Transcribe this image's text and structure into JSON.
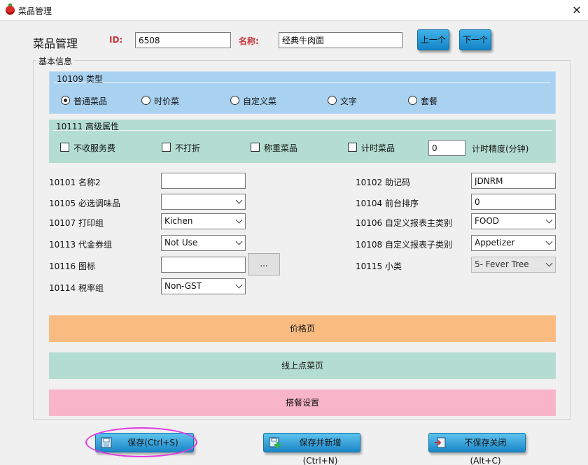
{
  "window": {
    "title": "菜品管理",
    "close_glyph": "✕"
  },
  "header": {
    "heading": "菜品管理",
    "id_label": "ID:",
    "id_value": "6508",
    "name_label": "名称:",
    "name_value": "经典牛肉面",
    "prev_label": "上一个",
    "next_label": "下一个"
  },
  "basic_group": {
    "title": "基本信息"
  },
  "type_section": {
    "title": "10109 类型",
    "options": [
      "普通菜品",
      "时价菜",
      "自定义菜",
      "文字",
      "套餐"
    ],
    "selected_index": 0
  },
  "advanced_section": {
    "title": "10111 高级属性",
    "checkboxes": [
      "不收服务费",
      "不打折",
      "称重菜品",
      "计时菜品"
    ],
    "checked": [
      false,
      false,
      false,
      false
    ],
    "precision_value": "0",
    "precision_label": "计时精度(分钟)"
  },
  "fields": {
    "name2": {
      "label": "10101 名称2",
      "value": ""
    },
    "mnemonic": {
      "label": "10102 助记码",
      "value": "JDNRM"
    },
    "seasoning": {
      "label": "10105 必选调味品",
      "value": ""
    },
    "sort": {
      "label": "10104 前台排序",
      "value": "0"
    },
    "print_group": {
      "label": "10107 打印组",
      "value": "Kichen"
    },
    "report_main": {
      "label": "10106 自定义报表主类别",
      "value": "FOOD"
    },
    "voucher_group": {
      "label": "10113 代金券组",
      "value": "Not Use"
    },
    "report_sub": {
      "label": "10108 自定义报表子类别",
      "value": "Appetizer"
    },
    "icon": {
      "label": "10116 图标",
      "value": "",
      "browse_label": "..."
    },
    "subcategory": {
      "label": "10115 小类",
      "value": "5- Fever Tree"
    },
    "tax_group": {
      "label": "10114 税率组",
      "value": "Non-GST"
    }
  },
  "sections": {
    "price": "价格页",
    "online": "线上点菜页",
    "combo": "搭餐设置"
  },
  "footer": {
    "save": "保存(Ctrl+S)",
    "save_new": "保存并新增(Ctrl+N)",
    "close_nosave": "不保存关闭(Alt+C)"
  },
  "colors": {
    "type_band": "#a9d2f1",
    "advanced_band": "#b3ddd0",
    "price_bar": "#f9bb80",
    "online_bar": "#b3ddd0",
    "combo_bar": "#f8b5ca",
    "button_blue": "#1b86c7",
    "highlight": "#e03ce0"
  }
}
